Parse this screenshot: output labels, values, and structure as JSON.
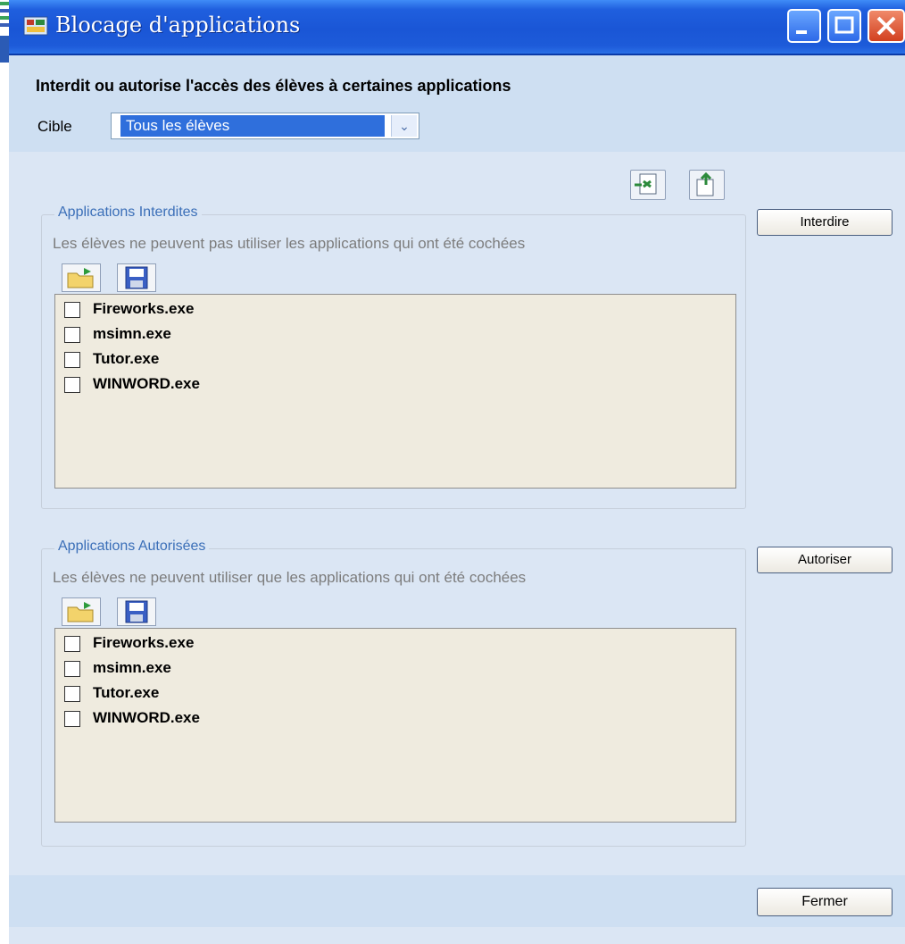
{
  "window": {
    "title": "Blocage d'applications"
  },
  "header": {
    "title": "Interdit ou autorise l'accès des élèves à certaines applications",
    "cible_label": "Cible",
    "cible_value": "Tous les élèves"
  },
  "groups": {
    "interdites": {
      "title": "Applications Interdites",
      "description": "Les élèves ne peuvent pas utiliser les applications qui ont été cochées",
      "items": [
        {
          "label": "Fireworks.exe",
          "checked": false
        },
        {
          "label": "msimn.exe",
          "checked": false
        },
        {
          "label": "Tutor.exe",
          "checked": false
        },
        {
          "label": "WINWORD.exe",
          "checked": false
        }
      ]
    },
    "autorisees": {
      "title": "Applications Autorisées",
      "description": "Les élèves ne peuvent utiliser que les applications qui ont été cochées",
      "items": [
        {
          "label": "Fireworks.exe",
          "checked": false
        },
        {
          "label": "msimn.exe",
          "checked": false
        },
        {
          "label": "Tutor.exe",
          "checked": false
        },
        {
          "label": "WINWORD.exe",
          "checked": false
        }
      ]
    }
  },
  "buttons": {
    "interdire": "Interdire",
    "autoriser": "Autoriser",
    "fermer": "Fermer"
  },
  "icons": {
    "import": "import-icon",
    "export": "export-icon",
    "open": "open-folder-icon",
    "save": "floppy-save-icon"
  },
  "colors": {
    "titlebar": "#1a56d6",
    "window_bg": "#dbe6f4",
    "list_bg": "#efebdf",
    "selection": "#2f6fdc"
  }
}
